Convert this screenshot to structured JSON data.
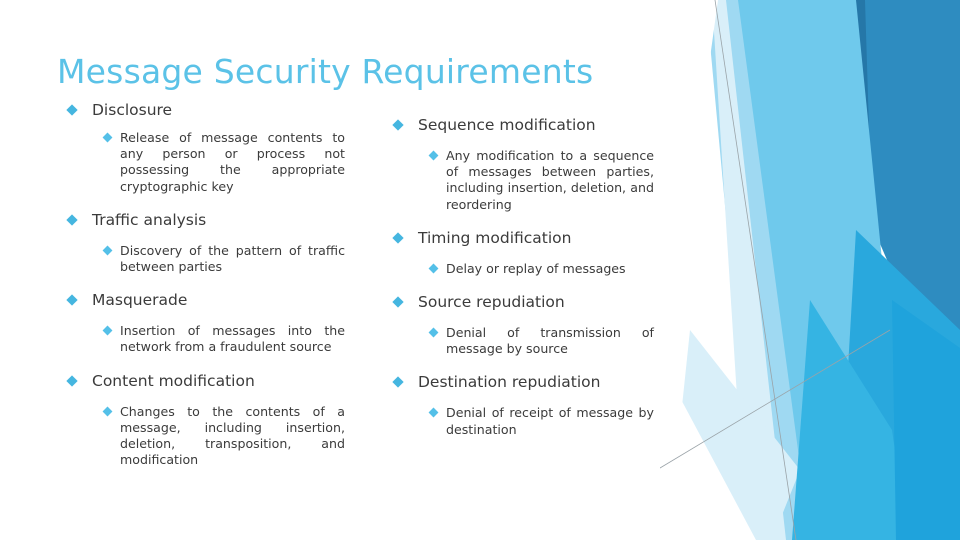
{
  "slide": {
    "title": "Message Security Requirements",
    "background_color": "#ffffff",
    "title_color": "#5BC2E7",
    "bullet_color": "#45B6E0",
    "text_color": "#3b3b3b",
    "decor_colors": {
      "pale_blue": "#D9EFF9",
      "light_blue": "#9FD9F2",
      "sky_blue": "#6FC9EC",
      "mid_blue": "#35B4E3",
      "azure": "#29A8DD",
      "steel_blue": "#2E8CC0",
      "deep_blue": "#2577A8",
      "line_grey": "#9aa3a8"
    }
  },
  "columns": {
    "left": [
      {
        "heading": "Disclosure",
        "detail": "Release of message contents to any person or process not possessing the appropriate cryptographic key"
      },
      {
        "heading": "Traffic analysis",
        "detail": "Discovery of the pattern of traffic between parties"
      },
      {
        "heading": "Masquerade",
        "detail": "Insertion of messages into the network from a fraudulent source"
      },
      {
        "heading": "Content modification",
        "detail": "Changes to the contents of a message, including insertion, deletion, transposition, and modification"
      }
    ],
    "right": [
      {
        "heading": "Sequence modification",
        "detail": "Any modification to a sequence of messages between parties, including insertion, deletion, and reordering"
      },
      {
        "heading": "Timing modification",
        "detail": "Delay or replay of messages"
      },
      {
        "heading": "Source repudiation",
        "detail": "Denial of transmission of message by source"
      },
      {
        "heading": "Destination repudiation",
        "detail": "Denial of receipt of message by destination"
      }
    ]
  }
}
